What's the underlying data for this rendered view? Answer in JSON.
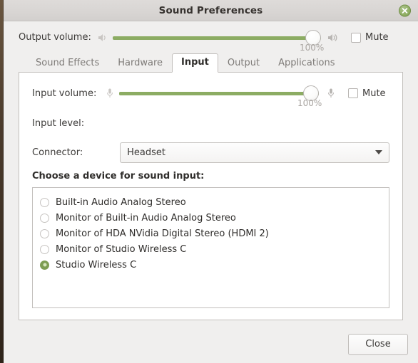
{
  "window": {
    "title": "Sound Preferences",
    "close_icon": "close-circle-icon"
  },
  "output": {
    "label": "Output volume:",
    "low_icon": "speaker-low-icon",
    "high_icon": "speaker-high-icon",
    "percent": "100%",
    "value": 100,
    "mute_label": "Mute",
    "mute_checked": false
  },
  "tabs": [
    {
      "label": "Sound Effects",
      "active": false
    },
    {
      "label": "Hardware",
      "active": false
    },
    {
      "label": "Input",
      "active": true
    },
    {
      "label": "Output",
      "active": false
    },
    {
      "label": "Applications",
      "active": false
    }
  ],
  "input_tab": {
    "volume": {
      "label": "Input volume:",
      "low_icon": "microphone-low-icon",
      "high_icon": "microphone-high-icon",
      "percent": "100%",
      "value": 100,
      "mute_label": "Mute",
      "mute_checked": false
    },
    "level": {
      "label": "Input level:"
    },
    "connector": {
      "label": "Connector:",
      "value": "Headset",
      "caret_icon": "chevron-down-icon"
    },
    "devices": {
      "heading": "Choose a device for sound input:",
      "items": [
        {
          "label": "Built-in Audio Analog Stereo",
          "selected": false
        },
        {
          "label": "Monitor of Built-in Audio Analog Stereo",
          "selected": false
        },
        {
          "label": "Monitor of HDA NVidia Digital Stereo (HDMI 2)",
          "selected": false
        },
        {
          "label": "Monitor of Studio Wireless C",
          "selected": false
        },
        {
          "label": "Studio Wireless C",
          "selected": true
        }
      ]
    }
  },
  "footer": {
    "close_label": "Close"
  },
  "colors": {
    "accent_green": "#8cac63",
    "selected_radio": "#7d9d52",
    "window_bg": "#f0efee",
    "titlebar_bg": "#d8d5d3",
    "panel_bg": "#ffffff"
  }
}
